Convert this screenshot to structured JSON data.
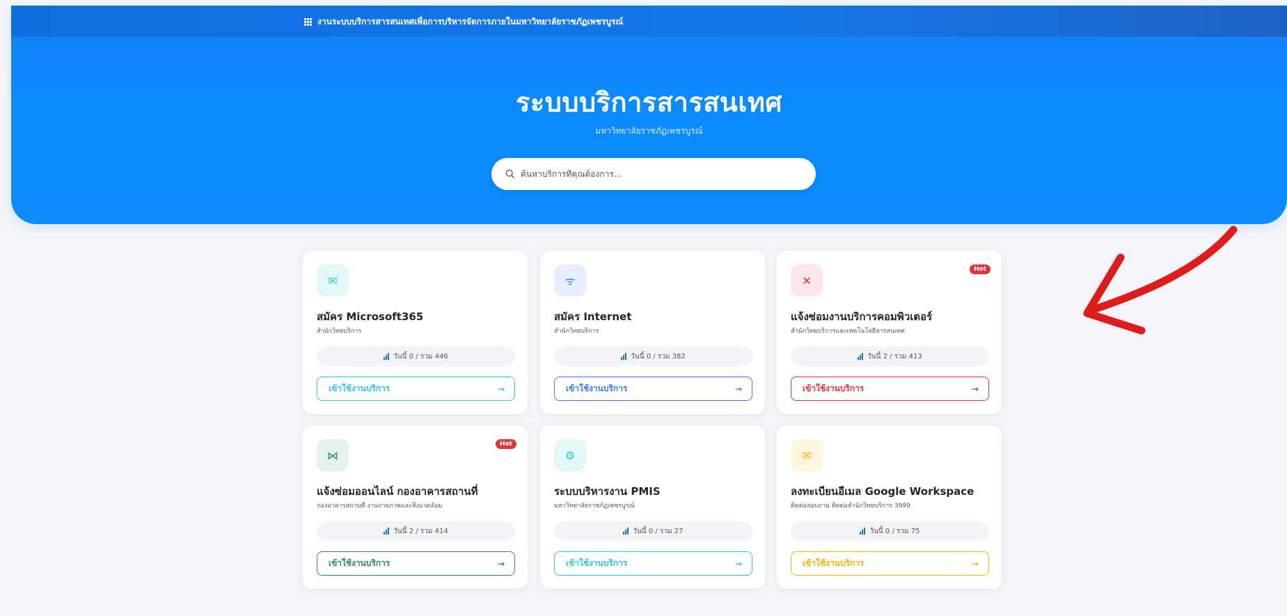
{
  "topbar": {
    "title": "งานระบบบริการสารสนเทศเพื่อการบริหารจัดการภายในมหาวิทยาลัยราชภัฏเพชรบูรณ์"
  },
  "hero": {
    "title": "ระบบบริการสารสนเทศ",
    "subtitle": "มหาวิทยาลัยราชภัฏเพชรบูรณ์",
    "search_placeholder": "ค้นหาบริการที่คุณต้องการ..."
  },
  "cards": [
    {
      "title": "สมัคร Microsoft365",
      "dept": "สำนักวิทยบริการ",
      "stat": "วันนี้ 0 / รวม 446",
      "button": "เข้าใช้งานบริการ",
      "arrow": "→",
      "hot": "",
      "icon": "mail-icon",
      "glyph": "✉",
      "accent": "#2ec7e0",
      "icon_bg": "#e3f7fb"
    },
    {
      "title": "สมัคร Internet",
      "dept": "สำนักวิทยบริการ",
      "stat": "วันนี้ 0 / รวม 382",
      "button": "เข้าใช้งานบริการ",
      "arrow": "→",
      "hot": "",
      "icon": "wifi-icon",
      "glyph": "ᯤ",
      "accent": "#3a7bf0",
      "icon_bg": "#e6efff"
    },
    {
      "title": "แจ้งซ่อมงานบริการคอมพิวเตอร์",
      "dept": "สำนักวิทยบริการและเทคโนโลยีสารสนเทศ",
      "stat": "วันนี้ 2 / รวม 413",
      "button": "เข้าใช้งานบริการ",
      "arrow": "→",
      "hot": "Hot",
      "icon": "tools-icon",
      "glyph": "✕",
      "accent": "#e2333b",
      "icon_bg": "#fde7e8"
    },
    {
      "title": "แจ้งซ่อมออนไลน์ กองอาคารสถานที่",
      "dept": "กองอาคารสถานที่ งานกายภาพและสิ่งแวดล้อม",
      "stat": "วันนี้ 2 / รวม 414",
      "button": "เข้าใช้งานบริการ",
      "arrow": "→",
      "hot": "Hot",
      "icon": "wrench-icon",
      "glyph": "⋈",
      "accent": "#2f8a5a",
      "icon_bg": "#e3f2ea"
    },
    {
      "title": "ระบบบริหารงาน PMIS",
      "dept": "มหาวิทยาลัยราชภัฏเพชรบูรณ์",
      "stat": "วันนี้ 0 / รวม 27",
      "button": "เข้าใช้งานบริการ",
      "arrow": "→",
      "hot": "",
      "icon": "gear-icon",
      "glyph": "⚙",
      "accent": "#2ec7e0",
      "icon_bg": "#e3f7fb"
    },
    {
      "title": "ลงทะเบียนอีเมล Google Workspace",
      "dept": "ติดต่อสอบถาม ติดต่อสำนักวิทยบริการ 3999",
      "stat": "วันนี้ 0 / รวม 75",
      "button": "เข้าใช้งานบริการ",
      "arrow": "→",
      "hot": "",
      "icon": "mail-icon",
      "glyph": "✉",
      "accent": "#f5b400",
      "icon_bg": "#fff5dc"
    }
  ],
  "annotation": {
    "color": "#e01b1b"
  }
}
